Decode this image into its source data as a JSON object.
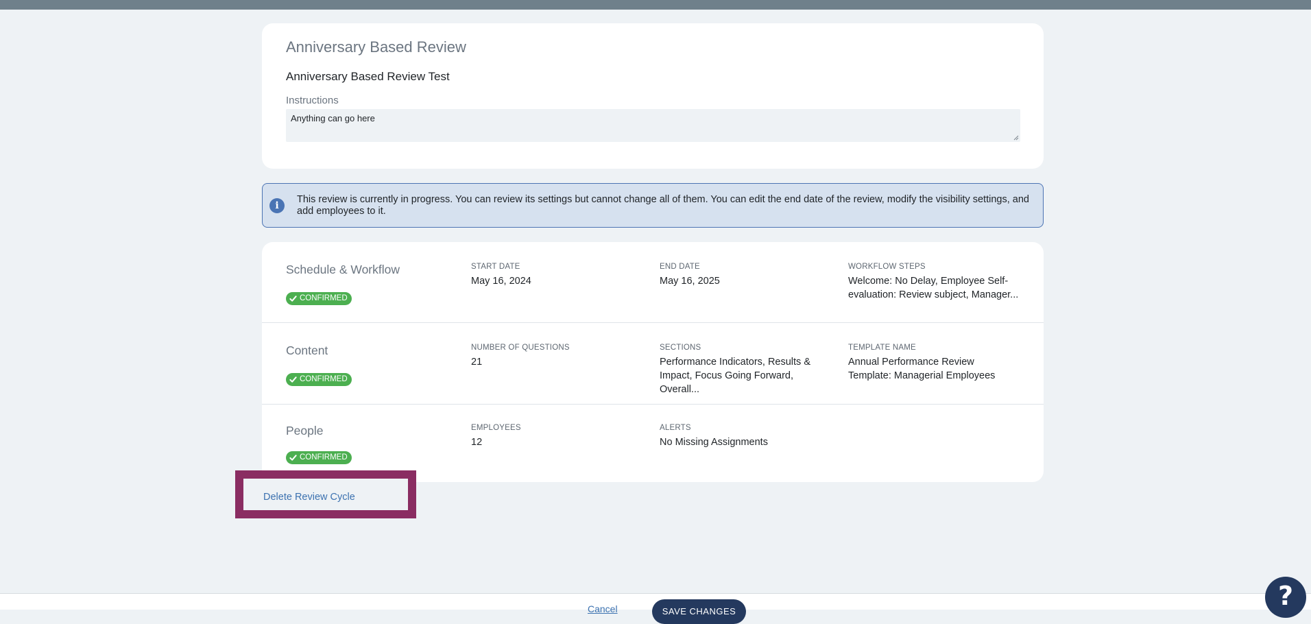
{
  "review": {
    "type_title": "Anniversary Based Review",
    "name": "Anniversary Based Review Test",
    "instructions_label": "Instructions",
    "instructions_text": "Anything can go here"
  },
  "info_banner": {
    "icon": "info-icon",
    "icon_glyph": "i",
    "text": "This review is currently in progress. You can review its settings but cannot change all of them. You can edit the end date of the review, modify the visibility settings, and add employees to it."
  },
  "sections": [
    {
      "title": "Schedule & Workflow",
      "status": "CONFIRMED",
      "fields": [
        {
          "label": "START DATE",
          "value": "May 16, 2024"
        },
        {
          "label": "END DATE",
          "value": "May 16, 2025"
        },
        {
          "label": "WORKFLOW STEPS",
          "value": "Welcome: No Delay, Employee Self-evaluation: Review subject, Manager..."
        }
      ]
    },
    {
      "title": "Content",
      "status": "CONFIRMED",
      "fields": [
        {
          "label": "NUMBER OF QUESTIONS",
          "value": "21"
        },
        {
          "label": "SECTIONS",
          "value": "Performance Indicators, Results & Impact, Focus Going Forward, Overall..."
        },
        {
          "label": "TEMPLATE NAME",
          "value": "Annual Performance Review Template: Managerial Employees"
        }
      ]
    },
    {
      "title": "People",
      "status": "CONFIRMED",
      "fields": [
        {
          "label": "EMPLOYEES",
          "value": "12"
        },
        {
          "label": "ALERTS",
          "value": "No Missing Assignments"
        }
      ]
    }
  ],
  "delete_link": "Delete Review Cycle",
  "footer": {
    "cancel_label": "Cancel",
    "save_label": "SAVE CHANGES"
  },
  "help_button_glyph": "?",
  "colors": {
    "top_bar": "#6f808b",
    "confirmed_badge": "#4caf50",
    "info_banner_bg": "#d6e1ef",
    "info_border": "#4b73b3",
    "primary_button": "#24395e",
    "link": "#3c72b0",
    "highlight_frame": "#8a2d62"
  }
}
